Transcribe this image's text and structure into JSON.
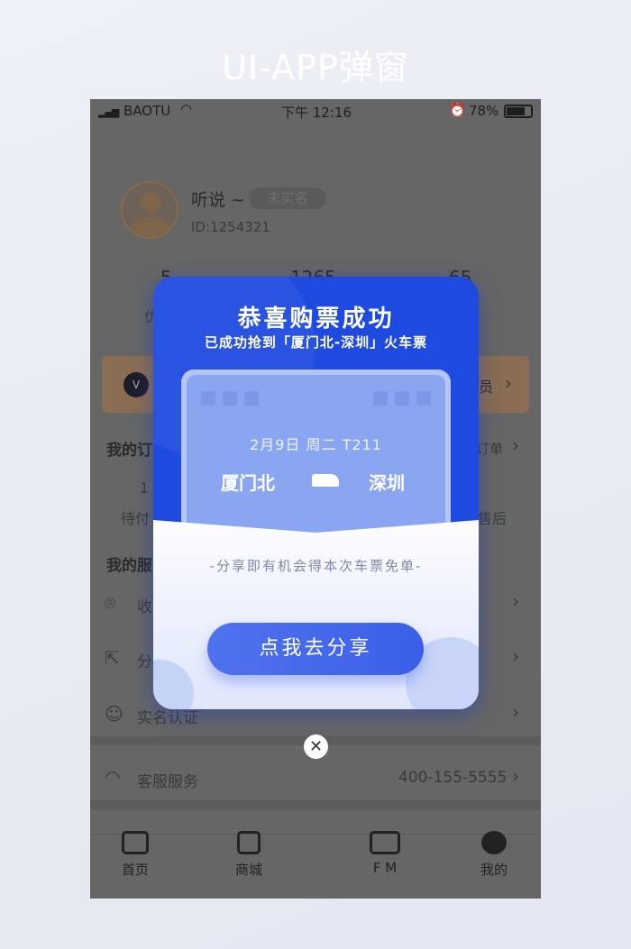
{
  "page_title": "UI-APP弹窗",
  "status_bar": {
    "carrier": "BAOTU",
    "time": "下午 12:16",
    "battery": "78%"
  },
  "profile": {
    "name": "听说 ~",
    "badge": "未实名",
    "id": "ID:1254321"
  },
  "stats": [
    "5",
    "1265",
    "65"
  ],
  "stat_label_fragment": "优",
  "vip": {
    "right_fragment": "员",
    "icon": "vip-badge-icon"
  },
  "orders": {
    "title_fragment": "我的订",
    "link_fragment": "订单",
    "count": "1",
    "left_label_fragment": "待付",
    "right_label_fragment": "售后"
  },
  "services": {
    "title_fragment": "我的服",
    "items": [
      {
        "label": "收",
        "icon": "location-icon"
      },
      {
        "label": "分",
        "icon": "share-icon"
      },
      {
        "label": "实名认证",
        "icon": "user-check-icon"
      }
    ]
  },
  "support": {
    "label": "客服服务",
    "phone": "400-155-5555",
    "icon": "headset-icon"
  },
  "tabs": [
    {
      "label": "首页",
      "icon": "home-icon"
    },
    {
      "label": "商城",
      "icon": "shop-icon"
    },
    {
      "label": "F M",
      "icon": "radio-icon"
    },
    {
      "label": "我的",
      "icon": "profile-icon"
    }
  ],
  "modal": {
    "title": "恭喜购票成功",
    "subtitle": "已成功抢到「厦门北-深圳」火车票",
    "ticket": {
      "date": "2月9日 周二 T211",
      "from": "厦门北",
      "to": "深圳"
    },
    "hint": "-分享即有机会得本次车票免单-",
    "button": "点我去分享"
  },
  "colors": {
    "accent": "#1f4ae0",
    "button": "#4566ec"
  }
}
